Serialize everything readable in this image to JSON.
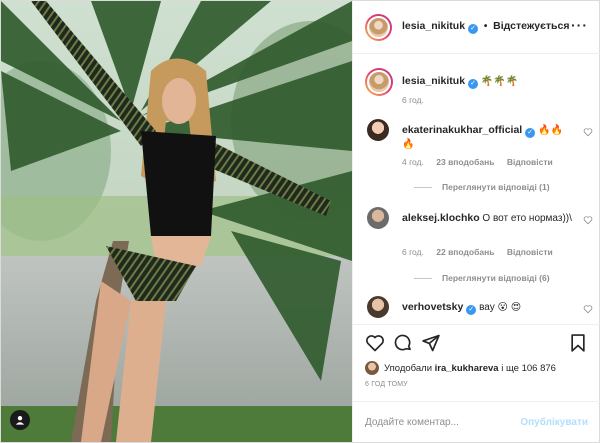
{
  "header": {
    "username": "lesia_nikituk",
    "separator": "•",
    "follow_state": "Відстежується",
    "more_icon": "more-horizontal-icon"
  },
  "caption": {
    "username": "lesia_nikituk",
    "text": "🌴🌴🌴",
    "time": "6 год."
  },
  "comments": [
    {
      "username": "ekaterinakukhar_official",
      "verified": true,
      "text": "🔥🔥🔥",
      "time": "4 год.",
      "likes": "23 вподобань",
      "reply": "Відповісти",
      "view_replies": "Переглянути відповіді (1)"
    },
    {
      "username": "aleksej.klochko",
      "verified": false,
      "text": "О вот ето нормаз))\\",
      "time": "6 год.",
      "likes": "22 вподобань",
      "reply": "Відповісти",
      "view_replies": "Переглянути відповіді (6)"
    },
    {
      "username": "verhovetsky",
      "verified": true,
      "text": "вау 😮 😍"
    }
  ],
  "likes": {
    "prefix": "Уподобали",
    "user": "ira_kukhareva",
    "suffix": "і ще 106 876"
  },
  "time_ago": "6 ГОД ТОМУ",
  "add_comment": {
    "placeholder": "Додайте коментар...",
    "publish": "Опублікувати"
  },
  "icons": {
    "like": "heart-icon",
    "comment": "comment-icon",
    "share": "paper-plane-icon",
    "save": "bookmark-icon",
    "tag": "user-tag-icon"
  },
  "colors": {
    "verified": "#3897f0",
    "publish_disabled": "#b2dffc",
    "secondary_text": "#8e8e8e"
  }
}
